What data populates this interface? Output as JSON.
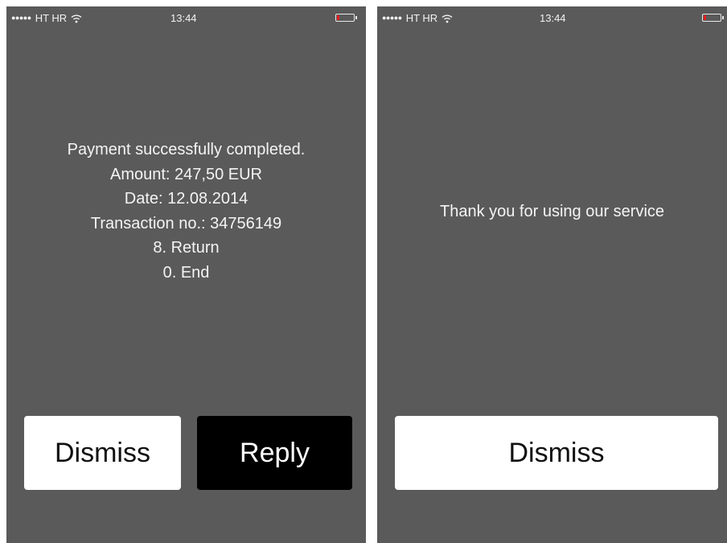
{
  "screens": [
    {
      "status_bar": {
        "signal": "●●●●●",
        "carrier": "HT HR",
        "wifi_icon": "wifi-icon",
        "time": "13:44",
        "battery_icon": "battery-low-icon",
        "battery_color": "#e02020"
      },
      "message_lines": [
        "Payment successfully completed.",
        "Amount: 247,50 EUR",
        "Date: 12.08.2014",
        "Transaction no.: 34756149",
        "8. Return",
        "0. End"
      ],
      "buttons": [
        {
          "label": "Dismiss"
        },
        {
          "label": "Reply"
        }
      ]
    },
    {
      "status_bar": {
        "signal": "●●●●●",
        "carrier": "HT HR",
        "wifi_icon": "wifi-icon",
        "time": "13:44",
        "battery_icon": "battery-low-icon",
        "battery_color": "#e02020"
      },
      "message_lines": [
        "Thank you for using our service"
      ],
      "buttons": [
        {
          "label": "Dismiss"
        }
      ]
    }
  ],
  "colors": {
    "screen_background": "#5a5a5a",
    "text": "#f4f4f4",
    "button_light": "#ffffff",
    "button_dark": "#000000"
  }
}
